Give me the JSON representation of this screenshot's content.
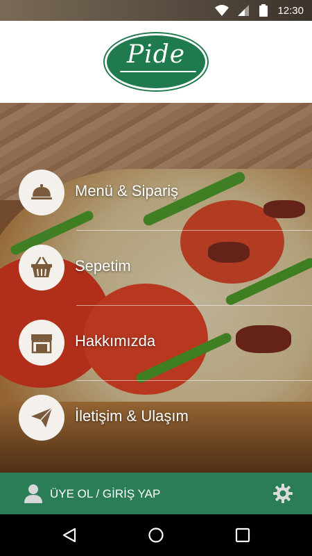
{
  "status_bar": {
    "time": "12:30",
    "icons": [
      "wifi-icon",
      "signal-icon",
      "battery-icon"
    ]
  },
  "header": {
    "logo_text": "Pide"
  },
  "menu": {
    "items": [
      {
        "label": "Menü & Sipariş",
        "icon": "cloche-icon"
      },
      {
        "label": "Sepetim",
        "icon": "basket-icon"
      },
      {
        "label": "Hakkımızda",
        "icon": "storefront-icon"
      },
      {
        "label": "İletişim & Ulaşım",
        "icon": "paper-plane-icon"
      }
    ]
  },
  "account_bar": {
    "label": "ÜYE OL / GİRİŞ YAP",
    "user_icon": "user-icon",
    "settings_icon": "gear-icon"
  },
  "nav_bar": {
    "buttons": [
      "back-icon",
      "home-icon",
      "recents-icon"
    ]
  },
  "colors": {
    "brand_green": "#2a7d56",
    "logo_green": "#1f7a4e",
    "icon_brown": "#7a5a3a",
    "circle_bg": "#f4f0ec"
  }
}
